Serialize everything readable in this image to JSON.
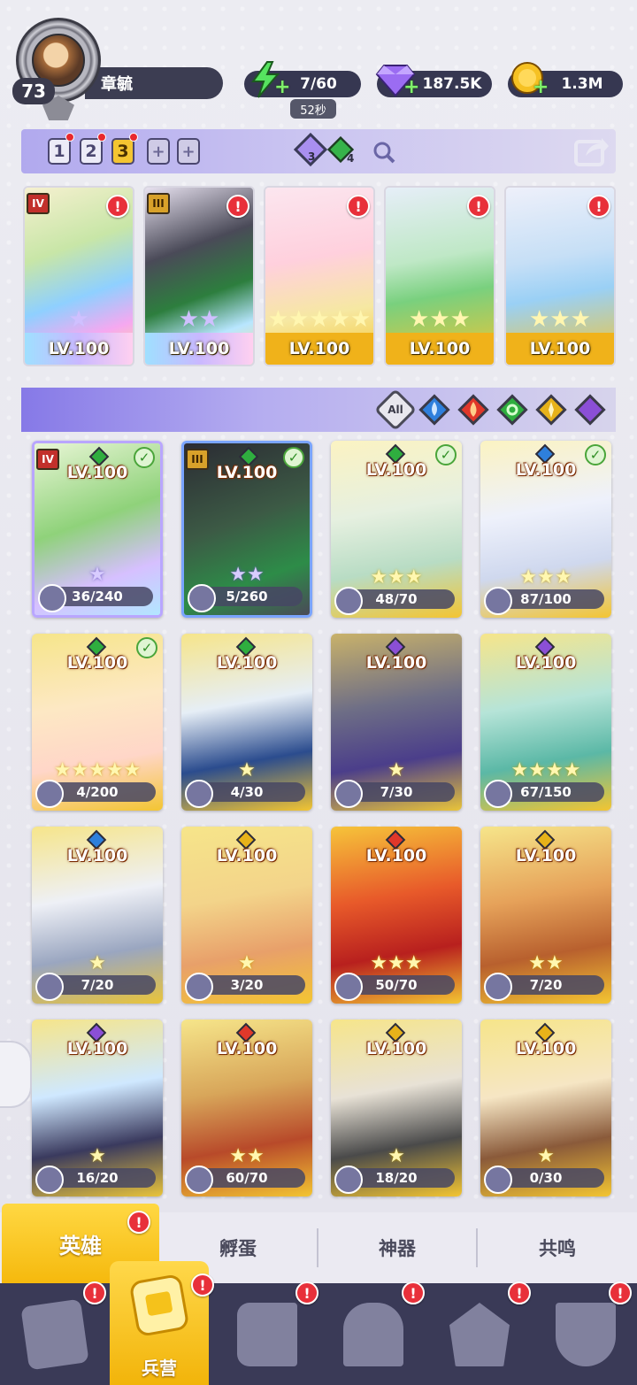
{
  "profile": {
    "level": "73",
    "name": "章毓"
  },
  "resources": {
    "energy": "7/60",
    "energy_timer": "52秒",
    "gems": "187.5K",
    "gold": "1.3M"
  },
  "team_slots": [
    {
      "label": "1",
      "active": false,
      "alert": true
    },
    {
      "label": "2",
      "active": false,
      "alert": true
    },
    {
      "label": "3",
      "active": true,
      "alert": true
    },
    {
      "label": "+",
      "type": "add"
    },
    {
      "label": "+",
      "type": "add"
    }
  ],
  "counters": {
    "purple_count": "3",
    "green_count": "4"
  },
  "featured": [
    {
      "level": "LV.100",
      "rank": "IV",
      "element": "green",
      "stars": 1,
      "alert": true
    },
    {
      "level": "LV.100",
      "rank": "III",
      "element": "green",
      "stars": 2,
      "alert": true
    },
    {
      "level": "LV.100",
      "element": "green",
      "stars": 5,
      "alert": true
    },
    {
      "level": "LV.100",
      "element": "green",
      "stars": 3,
      "alert": true
    },
    {
      "level": "LV.100",
      "element": "blue",
      "stars": 3,
      "alert": true
    }
  ],
  "filter": {
    "all_label": "All",
    "elements": [
      "water",
      "fire",
      "nature",
      "light",
      "dark"
    ]
  },
  "heroes": [
    {
      "level": "LV.100",
      "fragments": "36/240",
      "element": "green",
      "rank": "IV",
      "checked": true
    },
    {
      "level": "LV.100",
      "fragments": "5/260",
      "element": "green",
      "rank": "III",
      "checked": true
    },
    {
      "level": "LV.100",
      "fragments": "48/70",
      "element": "green",
      "checked": true
    },
    {
      "level": "LV.100",
      "fragments": "87/100",
      "element": "blue",
      "checked": true
    },
    {
      "level": "LV.100",
      "fragments": "4/200",
      "element": "green",
      "checked": true
    },
    {
      "level": "LV.100",
      "fragments": "4/30",
      "element": "green"
    },
    {
      "level": "LV.100",
      "fragments": "7/30",
      "element": "purple"
    },
    {
      "level": "LV.100",
      "fragments": "67/150",
      "element": "purple"
    },
    {
      "level": "LV.100",
      "fragments": "7/20",
      "element": "blue"
    },
    {
      "level": "LV.100",
      "fragments": "3/20",
      "element": "yellow"
    },
    {
      "level": "LV.100",
      "fragments": "50/70",
      "element": "red"
    },
    {
      "level": "LV.100",
      "fragments": "7/20",
      "element": "yellow"
    },
    {
      "level": "LV.100",
      "fragments": "16/20",
      "element": "purple"
    },
    {
      "level": "LV.100",
      "fragments": "60/70",
      "element": "red"
    },
    {
      "level": "LV.100",
      "fragments": "18/20",
      "element": "yellow"
    },
    {
      "level": "LV.100",
      "fragments": "0/30",
      "element": "yellow"
    }
  ],
  "subtabs": [
    "英雄",
    "孵蛋",
    "神器",
    "共鸣"
  ],
  "nav": {
    "active_label": "兵营",
    "items": [
      "cards",
      "barracks",
      "book",
      "castle",
      "mushroom",
      "guild"
    ]
  },
  "colors": {
    "green": "#2fae3f",
    "blue": "#2e7fdc",
    "red": "#e0382a",
    "yellow": "#e7b21a",
    "purple": "#8b4fd6",
    "accent_gold": "#f5c01a"
  }
}
